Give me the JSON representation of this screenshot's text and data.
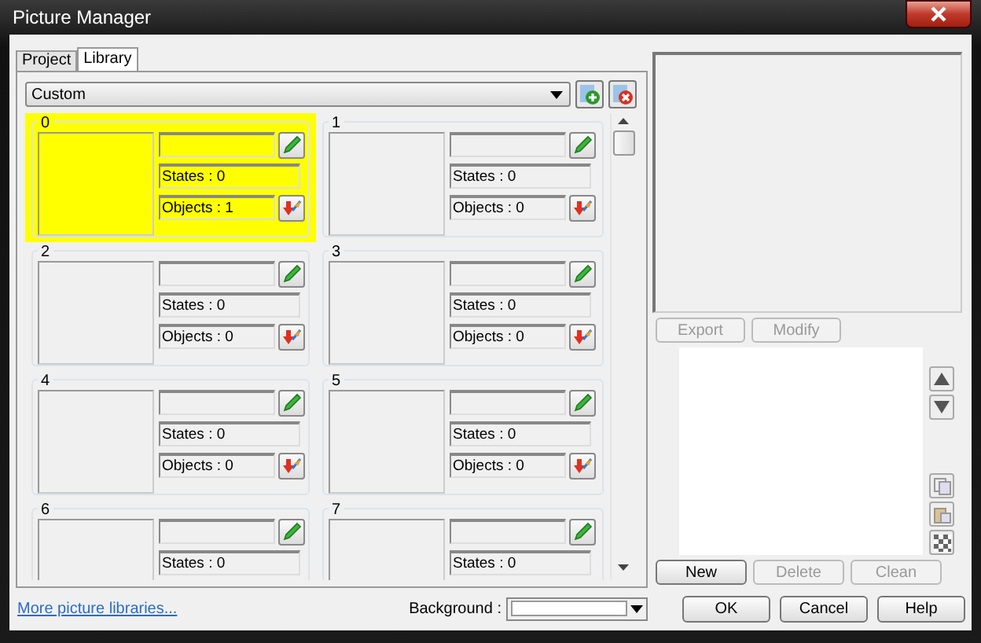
{
  "window": {
    "title": "Picture Manager"
  },
  "tabs": [
    {
      "label": "Project",
      "selected": false
    },
    {
      "label": "Library",
      "selected": true
    }
  ],
  "library_select": {
    "value": "Custom"
  },
  "pictures": [
    {
      "index": "0",
      "states": "States : 0",
      "objects": "Objects : 1",
      "selected": true
    },
    {
      "index": "1",
      "states": "States : 0",
      "objects": "Objects : 0",
      "selected": false
    },
    {
      "index": "2",
      "states": "States : 0",
      "objects": "Objects : 0",
      "selected": false
    },
    {
      "index": "3",
      "states": "States : 0",
      "objects": "Objects : 0",
      "selected": false
    },
    {
      "index": "4",
      "states": "States : 0",
      "objects": "Objects : 0",
      "selected": false
    },
    {
      "index": "5",
      "states": "States : 0",
      "objects": "Objects : 0",
      "selected": false
    },
    {
      "index": "6",
      "states": "States : 0",
      "selected": false
    },
    {
      "index": "7",
      "states": "States : 0",
      "selected": false
    }
  ],
  "preview_buttons": [
    {
      "label": "Export",
      "disabled": true
    },
    {
      "label": "Modify",
      "disabled": true
    }
  ],
  "state_buttons": [
    {
      "label": "New",
      "disabled": false
    },
    {
      "label": "Delete",
      "disabled": true
    },
    {
      "label": "Clean",
      "disabled": true
    }
  ],
  "footer": {
    "link": "More picture libraries...",
    "background_label": "Background :"
  },
  "dialog_buttons": [
    "OK",
    "Cancel",
    "Help"
  ]
}
